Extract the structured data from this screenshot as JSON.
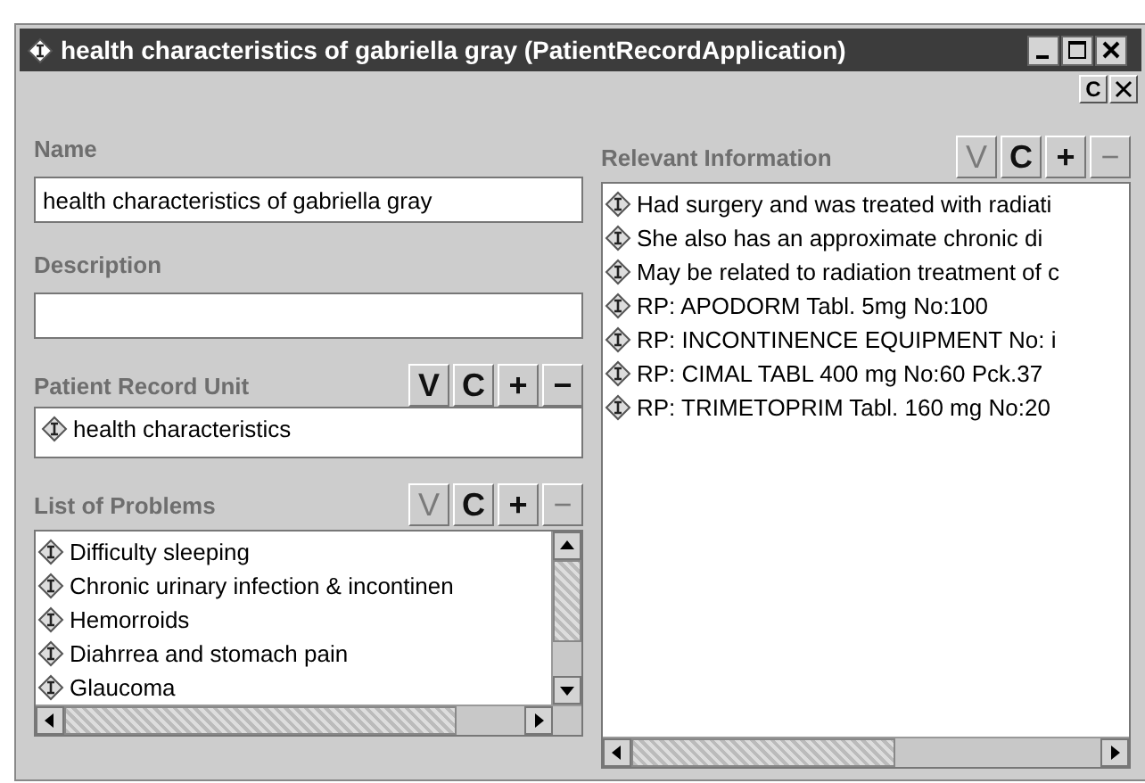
{
  "window": {
    "title": "health characteristics of gabriella gray (PatientRecordApplication)"
  },
  "toolbar": {
    "buttons": [
      "C"
    ]
  },
  "name_field": {
    "label": "Name",
    "value": "health characteristics of gabriella gray"
  },
  "description_field": {
    "label": "Description"
  },
  "panels": [
    {
      "title": "Patient Record Unit",
      "kind": "single",
      "buttons": [
        {
          "label": "V",
          "disabled": false
        },
        {
          "label": "C",
          "disabled": false
        },
        {
          "label": "+",
          "disabled": false
        },
        {
          "label": "−",
          "disabled": false
        }
      ],
      "items": [
        {
          "text": "health characteristics"
        }
      ]
    },
    {
      "title": "List of Problems",
      "kind": "list",
      "buttons": [
        {
          "label": "V",
          "disabled": true
        },
        {
          "label": "C",
          "disabled": false
        },
        {
          "label": "+",
          "disabled": false
        },
        {
          "label": "−",
          "disabled": true
        }
      ],
      "items": [
        {
          "text": "Difficulty sleeping"
        },
        {
          "text": "Chronic urinary infection & incontinen"
        },
        {
          "text": "Hemorroids"
        },
        {
          "text": "Diahrrea and stomach pain"
        },
        {
          "text": "Glaucoma"
        }
      ]
    },
    {
      "title": "Relevant Information",
      "kind": "wide",
      "buttons": [
        {
          "label": "V",
          "disabled": true
        },
        {
          "label": "C",
          "disabled": false
        },
        {
          "label": "+",
          "disabled": false
        },
        {
          "label": "−",
          "disabled": true
        }
      ],
      "items": [
        {
          "text": "Had surgery and was treated with radiati"
        },
        {
          "text": "She also has an approximate chronic di"
        },
        {
          "text": "May be related to radiation treatment of c"
        },
        {
          "text": "RP: APODORM Tabl. 5mg No:100"
        },
        {
          "text": "RP: INCONTINENCE EQUIPMENT No: i"
        },
        {
          "text": "RP: CIMAL TABL 400 mg No:60 Pck.37"
        },
        {
          "text": "RP: TRIMETOPRIM Tabl. 160 mg No:20"
        }
      ]
    }
  ]
}
